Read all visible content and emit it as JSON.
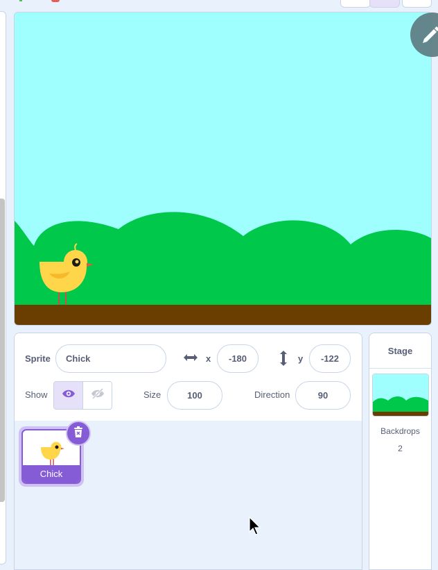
{
  "colors": {
    "bg": "#e9f1fc",
    "accent": "#855cd6",
    "sky": "#9fffff",
    "grass": "#00c84a",
    "ground": "#6a3e00"
  },
  "sprite_info": {
    "sprite_label": "Sprite",
    "sprite_name": "Chick",
    "x_label": "x",
    "x_value": "-180",
    "y_label": "y",
    "y_value": "-122",
    "show_label": "Show",
    "size_label": "Size",
    "size_value": "100",
    "direction_label": "Direction",
    "direction_value": "90"
  },
  "sprites": [
    {
      "name": "Chick",
      "selected": true
    }
  ],
  "stage_panel": {
    "title": "Stage",
    "backdrops_label": "Backdrops",
    "backdrops_count": "2"
  },
  "icons": [
    "pencil-icon",
    "horizontal-arrows-icon",
    "vertical-arrows-icon",
    "eye-icon",
    "eye-hidden-icon",
    "trash-icon",
    "cursor-icon"
  ]
}
